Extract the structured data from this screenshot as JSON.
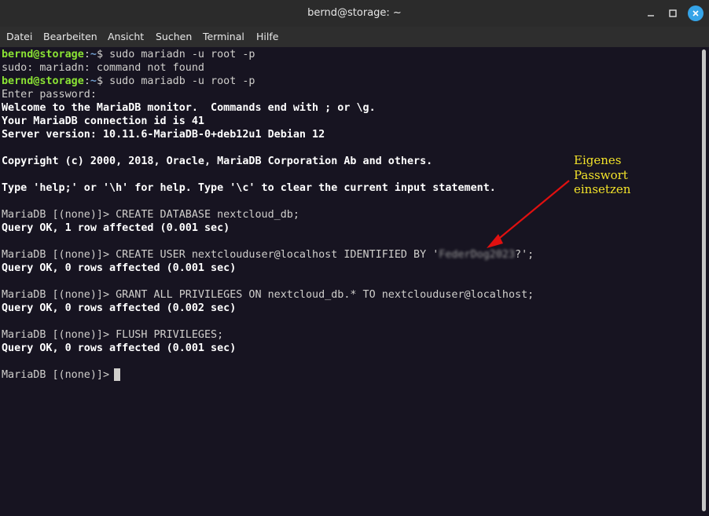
{
  "window": {
    "title": "bernd@storage: ~",
    "buttons": {
      "minimize": "–",
      "maximize": "□",
      "close": "✕"
    }
  },
  "menu": {
    "items": [
      "Datei",
      "Bearbeiten",
      "Ansicht",
      "Suchen",
      "Terminal",
      "Hilfe"
    ]
  },
  "terminal": {
    "prompt_user": "bernd@storage",
    "prompt_sep": ":",
    "prompt_path": "~",
    "prompt_dollar": "$ ",
    "cmd1": "sudo mariadn -u root -p",
    "err1": "sudo: mariadn: command not found",
    "cmd2": "sudo mariadb -u root -p",
    "enter_password": "Enter password:",
    "welcome": "Welcome to the MariaDB monitor.  Commands end with ; or \\g.",
    "conn_id": "Your MariaDB connection id is 41",
    "server_version": "Server version: 10.11.6-MariaDB-0+deb12u1 Debian 12",
    "copyright": "Copyright (c) 2000, 2018, Oracle, MariaDB Corporation Ab and others.",
    "help": "Type 'help;' or '\\h' for help. Type '\\c' to clear the current input statement.",
    "mariadb_prompt": "MariaDB [(none)]> ",
    "sql1": "CREATE DATABASE nextcloud_db;",
    "res1": "Query OK, 1 row affected (0.001 sec)",
    "sql2_pre": "CREATE USER nextclouduser@localhost IDENTIFIED BY '",
    "sql2_pw": "FederDog2023",
    "sql2_post": "?';",
    "res2": "Query OK, 0 rows affected (0.001 sec)",
    "sql3": "GRANT ALL PRIVILEGES ON nextcloud_db.* TO nextclouduser@localhost;",
    "res3": "Query OK, 0 rows affected (0.002 sec)",
    "sql4": "FLUSH PRIVILEGES;",
    "res4": "Query OK, 0 rows affected (0.001 sec)"
  },
  "annotation": {
    "lines": [
      "Eigenes",
      "Passwort",
      "einsetzen"
    ],
    "color": "#f2e22a",
    "arrow_color": "#e01010"
  },
  "colors": {
    "background": "#171421",
    "prompt_user": "#8ae234",
    "prompt_path": "#729fcf",
    "close_button": "#35a4e8"
  }
}
